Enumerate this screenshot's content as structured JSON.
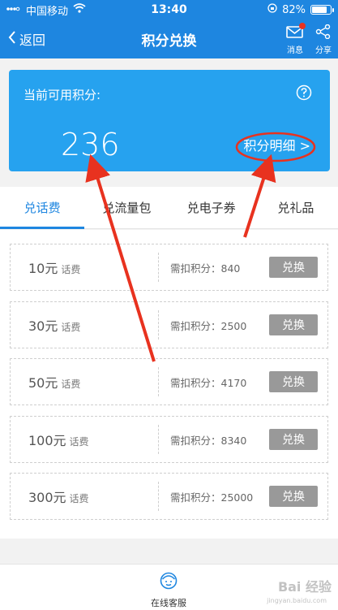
{
  "status_bar": {
    "carrier": "中国移动",
    "time": "13:40",
    "battery": "82%",
    "battery_level": 0.82
  },
  "nav": {
    "back_label": "返回",
    "title": "积分兑换",
    "message_label": "消息",
    "share_label": "分享"
  },
  "points_card": {
    "label": "当前可用积分:",
    "value": "236",
    "detail_link": "积分明细 >"
  },
  "tabs": [
    {
      "label": "兑话费"
    },
    {
      "label": "兑流量包"
    },
    {
      "label": "兑电子券"
    },
    {
      "label": "兑礼品"
    }
  ],
  "vouchers": [
    {
      "amount": "10元",
      "type": "话费",
      "cost": "需扣积分：840",
      "button": "兑换"
    },
    {
      "amount": "30元",
      "type": "话费",
      "cost": "需扣积分：2500",
      "button": "兑换"
    },
    {
      "amount": "50元",
      "type": "话费",
      "cost": "需扣积分：4170",
      "button": "兑换"
    },
    {
      "amount": "100元",
      "type": "话费",
      "cost": "需扣积分：8340",
      "button": "兑换"
    },
    {
      "amount": "300元",
      "type": "话费",
      "cost": "需扣积分：25000",
      "button": "兑换"
    }
  ],
  "bottom": {
    "service_label": "在线客服",
    "watermark": "Bai 经验",
    "watermark_sub": "jingyan.baidu.com"
  },
  "colors": {
    "primary": "#1e86e0",
    "card": "#26a2ef",
    "annotation": "#e8321f",
    "button": "#999999"
  }
}
